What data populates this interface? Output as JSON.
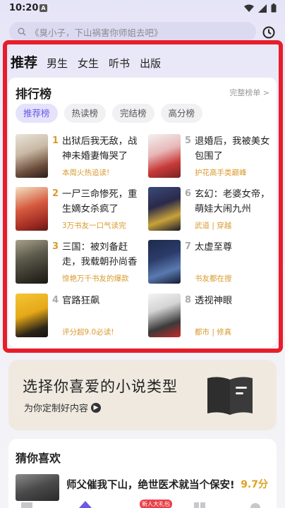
{
  "status_bar": {
    "time": "10:20",
    "notif_letter": "A"
  },
  "search": {
    "placeholder": "《臭小子，下山祸害你师姐去吧》"
  },
  "top_tabs": [
    {
      "label": "推荐",
      "active": true
    },
    {
      "label": "男生",
      "active": false
    },
    {
      "label": "女生",
      "active": false
    },
    {
      "label": "听书",
      "active": false
    },
    {
      "label": "出版",
      "active": false
    }
  ],
  "ranking": {
    "title": "排行榜",
    "more_label": "完整榜单 >",
    "chips": [
      {
        "label": "推荐榜",
        "active": true
      },
      {
        "label": "热读榜",
        "active": false
      },
      {
        "label": "完结榜",
        "active": false
      },
      {
        "label": "高分榜",
        "active": false
      }
    ],
    "books": [
      {
        "rank": "1",
        "title": "出狱后我无敌，战神未婚妻悔哭了",
        "sub": "本周火热追读!",
        "rank_color": "#d89a2c"
      },
      {
        "rank": "2",
        "title": "一尸三命惨死，重生嫡女杀疯了",
        "sub": "3万书友一口气读完",
        "rank_color": "#d89a2c"
      },
      {
        "rank": "3",
        "title": "三国：被刘备赶走，我载朝孙尚香",
        "sub": "惊艳万千书友的爆款",
        "rank_color": "#d89a2c"
      },
      {
        "rank": "4",
        "title": "官路狂飙",
        "sub": "评分超9.0必读!",
        "rank_color": "#aaaaaa"
      },
      {
        "rank": "5",
        "title": "退婚后，我被美女包围了",
        "sub": "护花高手类巅峰",
        "rank_color": "#aaaaaa"
      },
      {
        "rank": "6",
        "title": "玄幻：老婆女帝，萌娃大闹九州",
        "sub": "武道 | 穿越",
        "rank_color": "#aaaaaa"
      },
      {
        "rank": "7",
        "title": "太虚至尊",
        "sub": "书友都在搜",
        "rank_color": "#aaaaaa"
      },
      {
        "rank": "8",
        "title": "透视神眼",
        "sub": "都市 | 修真",
        "rank_color": "#aaaaaa"
      }
    ]
  },
  "genre_banner": {
    "title": "选择你喜爱的小说类型",
    "subtitle": "为你定制好内容"
  },
  "guess": {
    "title": "猜你喜欢",
    "book_title": "师父催我下山，绝世医术就当个保安!",
    "score": "9.7分"
  },
  "bottom_nav": {
    "badge": "新人大礼包"
  },
  "colors": {
    "accent": "#6a58e6",
    "frame": "#e81d2a",
    "gold": "#d89a2c"
  }
}
